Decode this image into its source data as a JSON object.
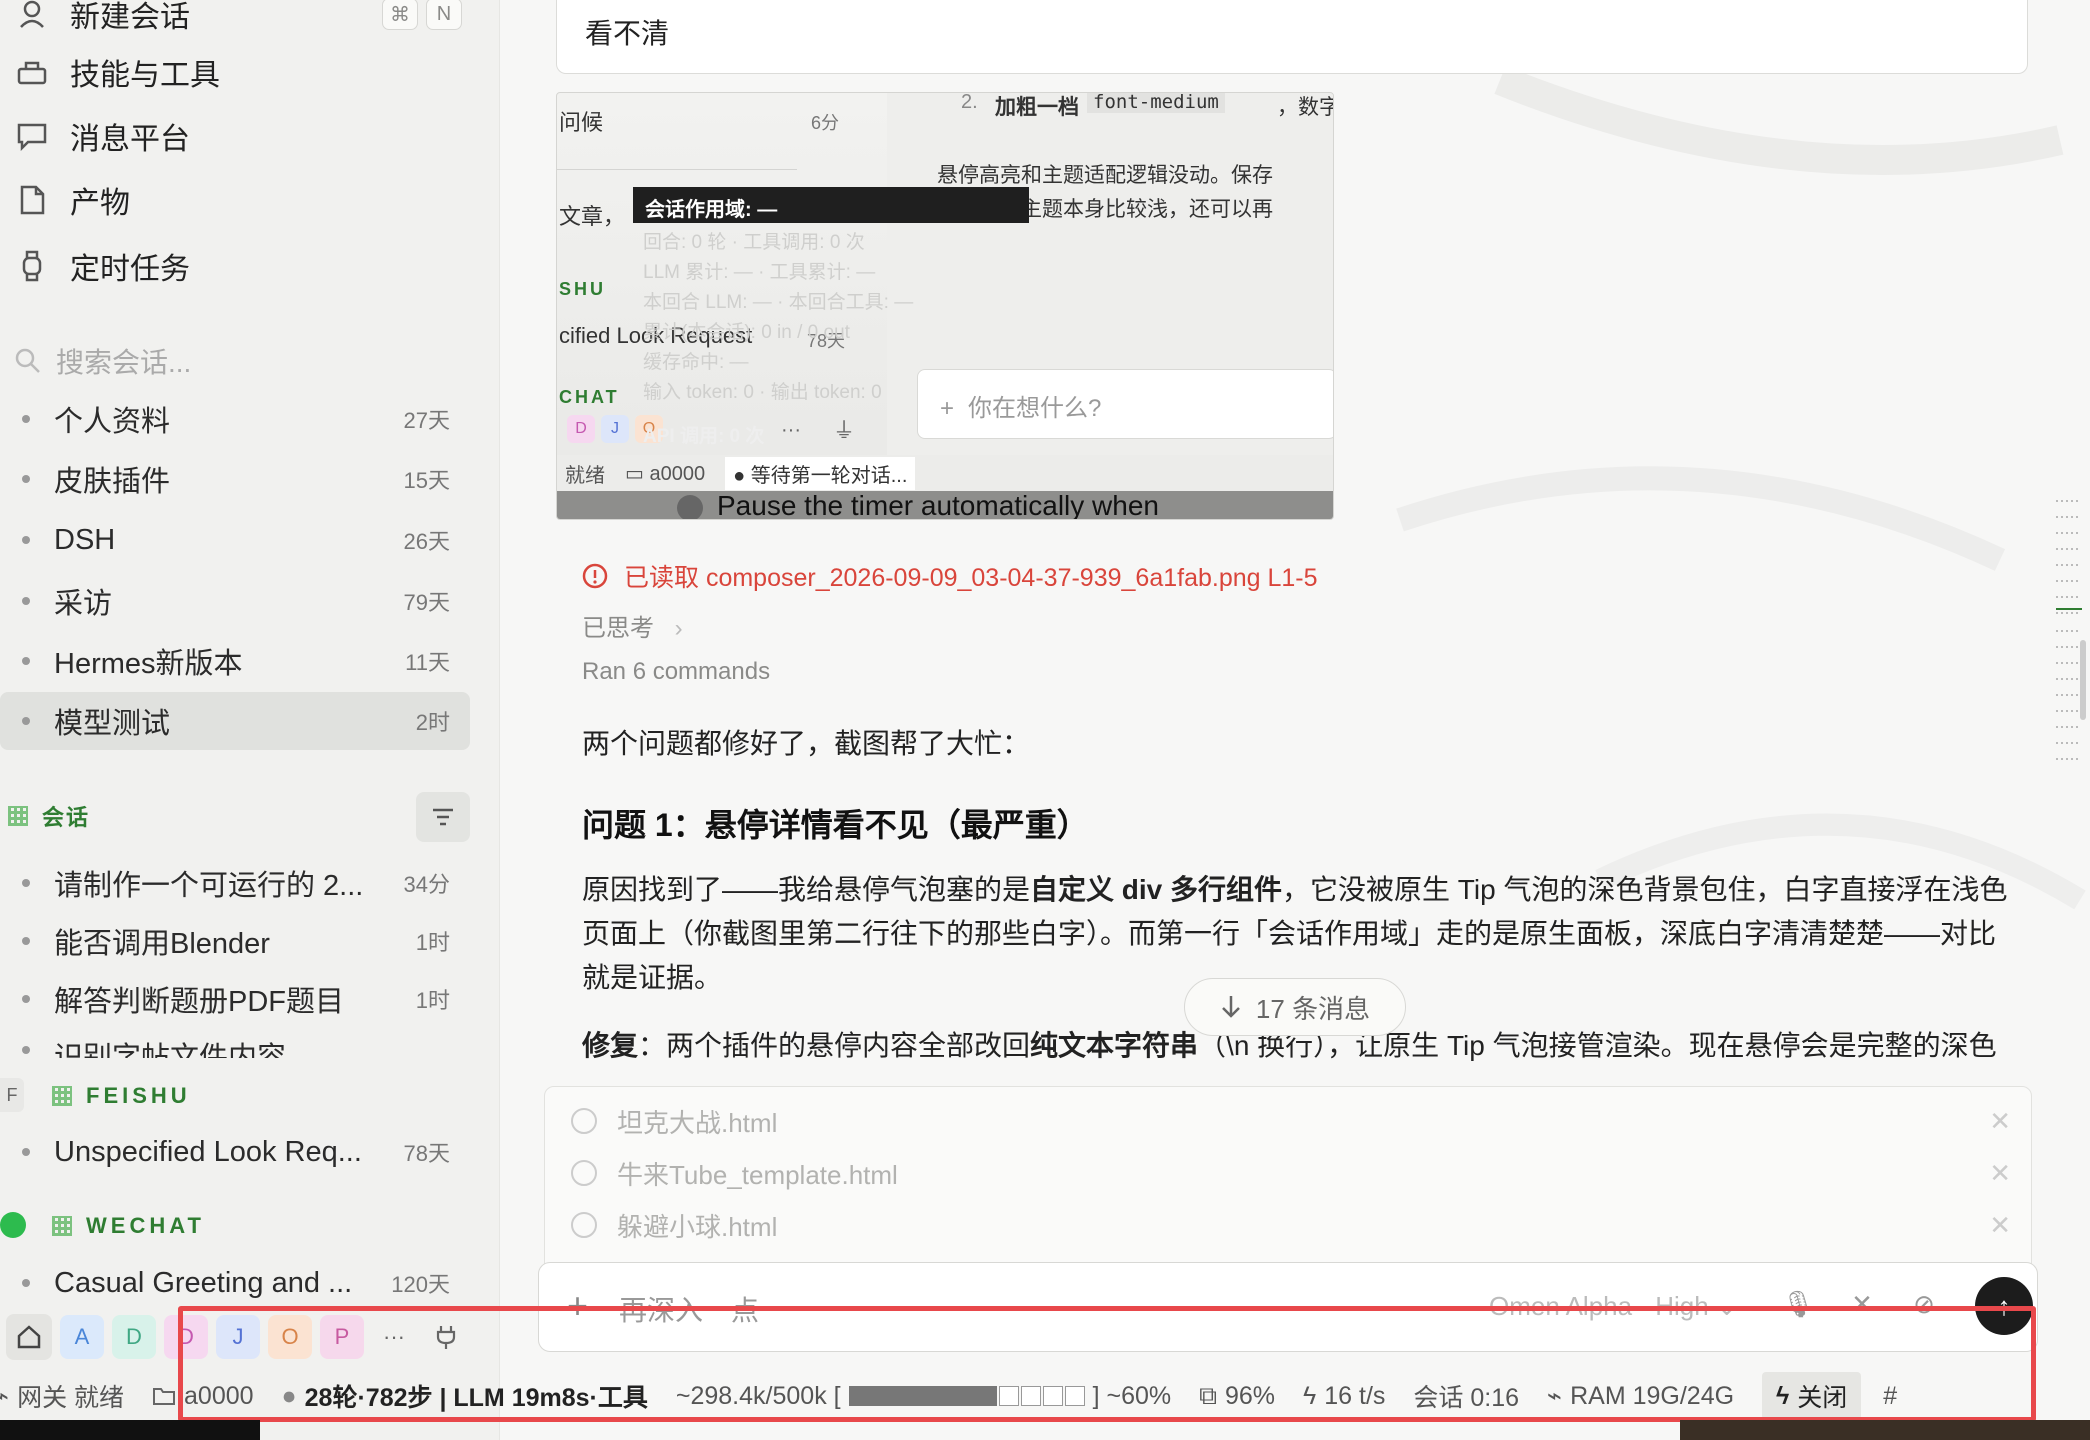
{
  "sidebar": {
    "nav": [
      {
        "label": "新建会话",
        "kbd1": "⌘",
        "kbd2": "N"
      },
      {
        "label": "技能与工具"
      },
      {
        "label": "消息平台"
      },
      {
        "label": "产物"
      },
      {
        "label": "定时任务"
      }
    ],
    "search_placeholder": "搜索会话...",
    "projects": [
      {
        "label": "个人资料",
        "age": "27天"
      },
      {
        "label": "皮肤插件",
        "age": "15天"
      },
      {
        "label": "DSH",
        "age": "26天"
      },
      {
        "label": "采访",
        "age": "79天"
      },
      {
        "label": "Hermes新版本",
        "age": "11天"
      },
      {
        "label": "模型测试",
        "age": "2时"
      }
    ],
    "section_sessions": "会话",
    "sessions": [
      {
        "label": "请制作一个可运行的 2...",
        "age": "34分"
      },
      {
        "label": "能否调用Blender",
        "age": "1时"
      },
      {
        "label": "解答判断题册PDF题目",
        "age": "1时"
      },
      {
        "label": "识别字帖文件内容",
        "age": ""
      }
    ],
    "feishu_badge": "F",
    "section_feishu": "FEISHU",
    "feishu_items": [
      {
        "label": "Unspecified Look Req...",
        "age": "78天"
      }
    ],
    "section_wechat": "WECHAT",
    "wechat_items": [
      {
        "label": "Casual Greeting and ...",
        "age": "120天"
      }
    ],
    "chips": [
      "A",
      "D",
      "D",
      "J",
      "O",
      "P"
    ],
    "more": "···"
  },
  "main": {
    "top_message": "看不清",
    "shot": {
      "greet": "问候",
      "greet_age": "6分",
      "article": "文章，",
      "feishu": "SHU",
      "look": "cified Look Request",
      "look_age": "78天",
      "chat": "CHAT",
      "chips": [
        "D",
        "J",
        "O"
      ],
      "api": "API 调用: 0 次",
      "line1_num": "2.",
      "line1_bold": "加粗一档",
      "line1_code": "font-medium",
      "line1_tail": "，数字",
      "line2": "悬停高亮和主题适配逻辑没动。保存",
      "line3": "如果你的主题本身比较浅，还可以再",
      "tooltip": "会话作用域: —",
      "ghost_lines": [
        "回合: 0 轮 · 工具调用: 0 次",
        "LLM 累计: — · 工具累计: —",
        "本回合 LLM: — · 本回合工具: —",
        "累计(本会话): 0 in / 0 out",
        "缓存命中: —",
        "输入 token: 0 · 输出 token: 0"
      ],
      "input_ph": "你在想什么?",
      "status_ready": "就绪",
      "status_folder": "a0000",
      "status_wait": "等待第一轮对话...",
      "bottom_text": "Pause the timer automatically when"
    },
    "file_read": "已读取 composer_2026-09-09_03-04-37-939_6a1fab.png L1-5",
    "thought": "已思考",
    "ran": "Ran 6 commands",
    "p1": "两个问题都修好了，截图帮了大忙：",
    "h1": "问题 1：悬停详情看不见（最严重）",
    "para1_a": "原因找到了——我给悬停气泡塞的是",
    "para1_b": "自定义 div 多行组件",
    "para1_c": "，它没被原生 Tip 气泡的深色背景包住，白字直接浮在浅色页面上（你截图里第二行往下的那些白字）。而第一行「会话作用域」走的是原生面板，深底白字清清楚楚——对比就是证据。",
    "para2_a": "修复",
    "para2_b": "：两个插件的悬停内容全部改回",
    "para2_c": "纯文本字符串",
    "para2_d": "（\\n 换行），让原生 Tip 气泡接管渲染。现在悬停会是完整的深色气泡，多行数据全部可读。",
    "jump": "17 条消息",
    "attachments": [
      "坦克大战.html",
      "牛来Tube_template.html",
      "躲避小球.html"
    ],
    "composer_placeholder": "再深入一点",
    "model": "Omen Alpha · High",
    "send_icon": "↑"
  },
  "status": {
    "gateway": "网关 就绪",
    "folder": "a0000",
    "rounds": "28轮·782步 | LLM 19m8s·工具",
    "tokens": "~298.4k/500k [",
    "tokens_end": "] ~60%",
    "cache": "96%",
    "speed": "16 t/s",
    "session": "会话 0:16",
    "ram": "RAM 19G/24G",
    "close": "关闭",
    "hash": "#"
  },
  "colors": {
    "accent_green": "#2f7d32",
    "error_red": "#d9453b",
    "highlight_red": "#e8484b"
  }
}
